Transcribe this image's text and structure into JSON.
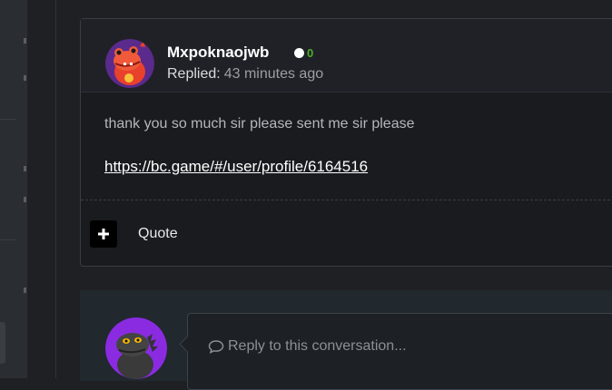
{
  "colors": {
    "accent_green": "#4cae2b",
    "link": "#ffffff",
    "muted": "#9a9ea5"
  },
  "post": {
    "username": "Mxpoknaojwb",
    "status_count": "0",
    "replied_label": "Replied:",
    "replied_time": "43 minutes ago",
    "message": "thank you so much sir please sent me sir please",
    "link": "https://bc.game/#/user/profile/6164516",
    "quote_label": "Quote",
    "avatar_icon": "red-dragon-avatar",
    "plus_icon": "plus-icon"
  },
  "reply": {
    "placeholder": "Reply to this conversation...",
    "avatar_icon": "dark-dinosaur-avatar",
    "comment_icon": "comment-icon"
  }
}
